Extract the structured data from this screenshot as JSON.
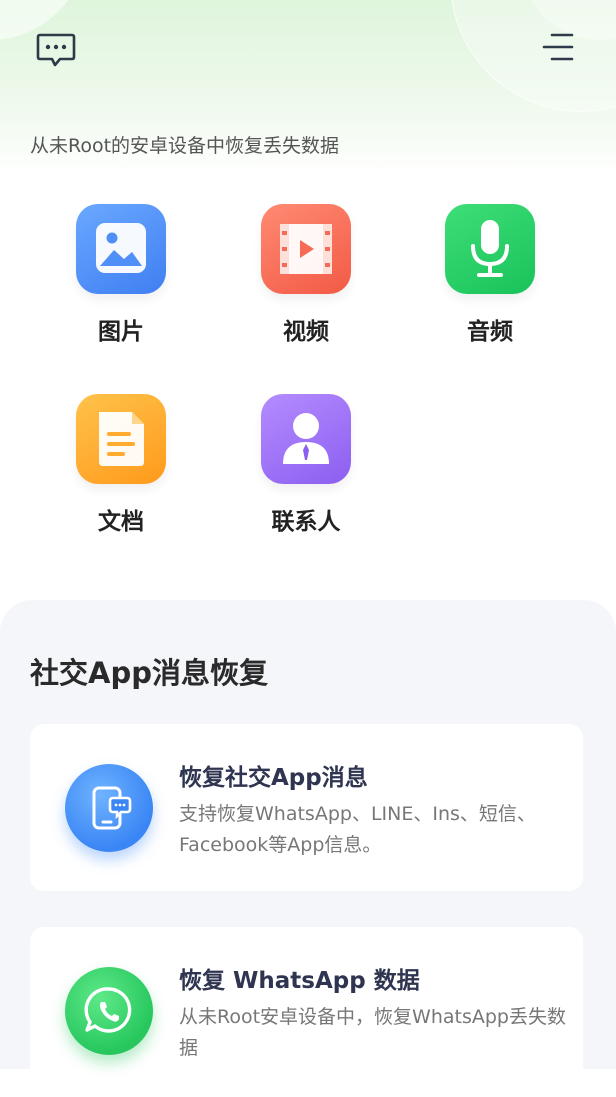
{
  "header": {
    "message_icon": "chat-bubble-icon",
    "menu_icon": "menu-icon",
    "subtitle": "从未Root的安卓设备中恢复丢失数据"
  },
  "categories": [
    {
      "label": "图片",
      "icon": "image-icon",
      "color": "#4f8ff7"
    },
    {
      "label": "视频",
      "icon": "video-icon",
      "color": "#f66b55"
    },
    {
      "label": "音频",
      "icon": "microphone-icon",
      "color": "#22cc63"
    },
    {
      "label": "文档",
      "icon": "document-icon",
      "color": "#ffab2e"
    },
    {
      "label": "联系人",
      "icon": "contact-icon",
      "color": "#9b6ef5"
    }
  ],
  "social": {
    "title": "社交App消息恢复",
    "cards": [
      {
        "title": "恢复社交App消息",
        "description": "支持恢复WhatsApp、LINE、Ins、短信、Facebook等App信息。",
        "icon": "phone-chat-icon"
      },
      {
        "title": "恢复 WhatsApp 数据",
        "description": "从未Root安卓设备中，恢复WhatsApp丢失数据",
        "icon": "whatsapp-icon"
      }
    ]
  }
}
